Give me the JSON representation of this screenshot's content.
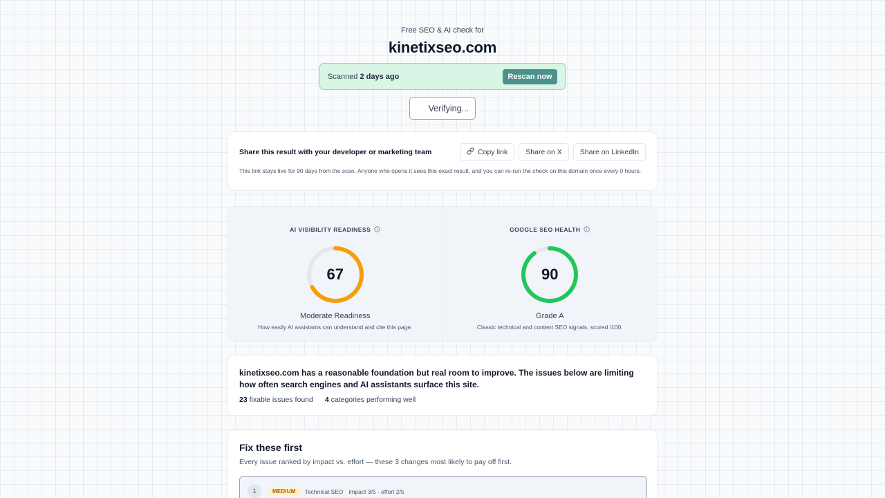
{
  "header": {
    "subtitle": "Free SEO & AI check for",
    "domain": "kinetixseo.com"
  },
  "scan": {
    "prefix": "Scanned",
    "when": "2 days ago",
    "rescan_label": "Rescan now"
  },
  "verify": {
    "text": "Verifying..."
  },
  "share": {
    "heading": "Share this result with your developer or marketing team",
    "copy_label": "Copy link",
    "x_label": "Share on X",
    "linkedin_label": "Share on LinkedIn",
    "note": "This link stays live for 90 days from the scan. Anyone who opens it sees this exact result, and you can re-run the check on this domain once every 0 hours."
  },
  "scores": {
    "ai": {
      "label": "AI VISIBILITY READINESS",
      "value": 67,
      "max": 100,
      "grade": "Moderate Readiness",
      "description": "How easily AI assistants can understand and cite this page.",
      "color": "#f59e0b"
    },
    "seo": {
      "label": "GOOGLE SEO HEALTH",
      "value": 90,
      "max": 100,
      "grade": "Grade A",
      "description": "Classic technical and content SEO signals, scored /100.",
      "color": "#22c55e"
    },
    "track_color": "#e5e7eb"
  },
  "summary": {
    "text": "kinetixseo.com has a reasonable foundation but real room to improve. The issues below are limiting how often search engines and AI assistants surface this site.",
    "issues_count": "23",
    "issues_label": "fixable issues found",
    "categories_count": "4",
    "categories_label": "categories performing well"
  },
  "fix": {
    "title": "Fix these first",
    "subtitle": "Every issue ranked by impact vs. effort — these 3 changes most likely to pay off first.",
    "items": [
      {
        "number": "1",
        "severity": "MEDIUM",
        "category": "Technical SEO",
        "impact": "impact 3/5 · effort 2/5"
      }
    ]
  }
}
